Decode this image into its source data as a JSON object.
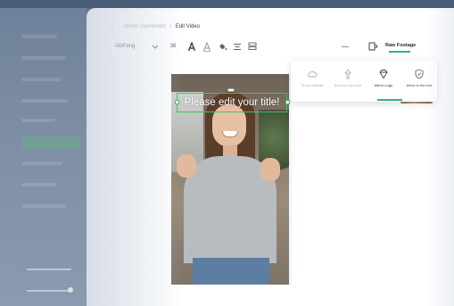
{
  "editor": {
    "breadcrumb": {
      "back_symbol": "‹",
      "previous": "Home Dashboard",
      "separator": "/",
      "current": "Edit Video"
    },
    "toolbar": {
      "font_name": "AlbFang",
      "font_size": "36",
      "footage_tab": "Raw Footage"
    },
    "video": {
      "title_text": "Please edit your title!"
    },
    "effect_popup": {
      "options": [
        {
          "label": "Show Outside",
          "icon": "cloud-icon"
        },
        {
          "label": "Arrow to the front",
          "icon": "arrow-front-icon"
        },
        {
          "label": "Mirror Logo",
          "icon": "diamond-icon"
        },
        {
          "label": "Move to the end",
          "icon": "shield-icon"
        }
      ],
      "selected_index": 2
    }
  },
  "colors": {
    "accent_green": "#31b47a",
    "selection_green": "#41c25e",
    "sidebar_active": "#6fa58f"
  }
}
